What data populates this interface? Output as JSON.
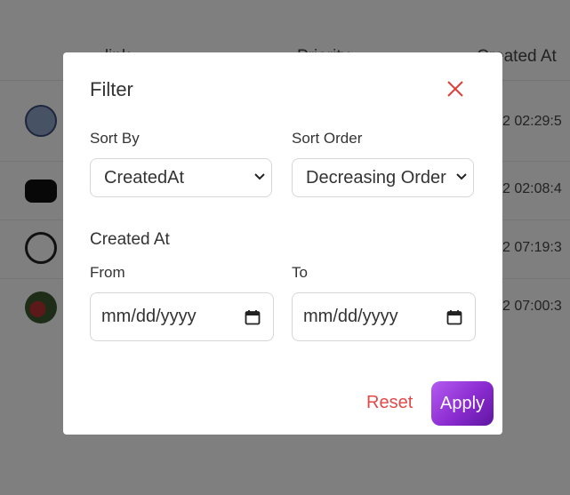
{
  "background": {
    "columns": [
      "...link",
      "Priority",
      "Created At"
    ],
    "rows": [
      {
        "thumb": "globe-thumbnail",
        "timestamp": "2 02:29:5"
      },
      {
        "thumb": "youtube-thumbnail",
        "timestamp": "2 02:08:4"
      },
      {
        "thumb": "list-thumbnail",
        "timestamp": "2 07:19:3"
      },
      {
        "thumb": "car-thumbnail",
        "timestamp": "2 07:00:3"
      }
    ]
  },
  "modal": {
    "title": "Filter",
    "close_icon": "close-icon",
    "sort_by": {
      "label": "Sort By",
      "value": "CreatedAt"
    },
    "sort_order": {
      "label": "Sort Order",
      "value": "Decreasing Order"
    },
    "created_at": {
      "title": "Created At",
      "from": {
        "label": "From",
        "placeholder": "mm/dd/yyyy"
      },
      "to": {
        "label": "To",
        "placeholder": "mm/dd/yyyy"
      }
    },
    "reset_label": "Reset",
    "apply_label": "Apply"
  },
  "colors": {
    "overlay": "#000000",
    "close": "#e53935",
    "reset": "#e04a4a",
    "apply_start": "#b45cf0",
    "apply_end": "#5e16a0"
  }
}
